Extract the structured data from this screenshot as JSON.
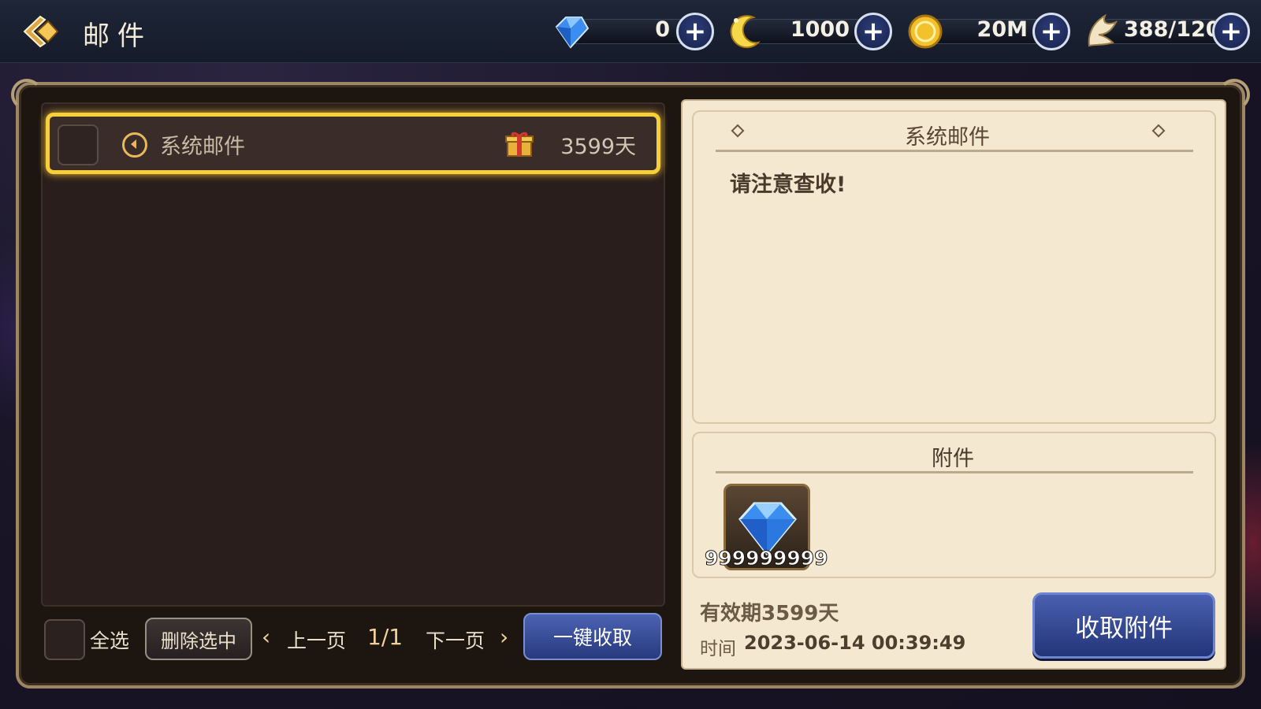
{
  "header": {
    "title": "邮件",
    "back_icon": "back-arrow-icon"
  },
  "resources": [
    {
      "icon": "diamond-icon",
      "value": "0"
    },
    {
      "icon": "crescent-icon",
      "value": "1000"
    },
    {
      "icon": "gold-coin-icon",
      "value": "20M"
    },
    {
      "icon": "wing-stamina-icon",
      "value": "388/120"
    }
  ],
  "plus_label": "+",
  "mail_list": {
    "items": [
      {
        "title": "系统邮件",
        "expire": "3599天",
        "icon": "speaker-icon",
        "attachment_icon": "gift-icon"
      }
    ]
  },
  "controls": {
    "select_all": "全选",
    "delete_selected": "删除选中",
    "prev_page": "上一页",
    "page": "1/1",
    "next_page": "下一页",
    "collect_all": "一键收取",
    "prev_arrow": "‹",
    "next_arrow": "›"
  },
  "detail": {
    "title": "系统邮件",
    "body": "请注意查收!",
    "attachment_header": "附件",
    "attachment": {
      "icon": "diamond-icon",
      "count": "999999999"
    },
    "validity": "有效期3599天",
    "time_label": "时间",
    "time_value": "2023-06-14 00:39:49",
    "claim_button": "收取附件"
  },
  "colors": {
    "highlight": "#f7cf3a",
    "accent_blue": "#2f4490",
    "panel_cream": "#f4e9d0"
  }
}
